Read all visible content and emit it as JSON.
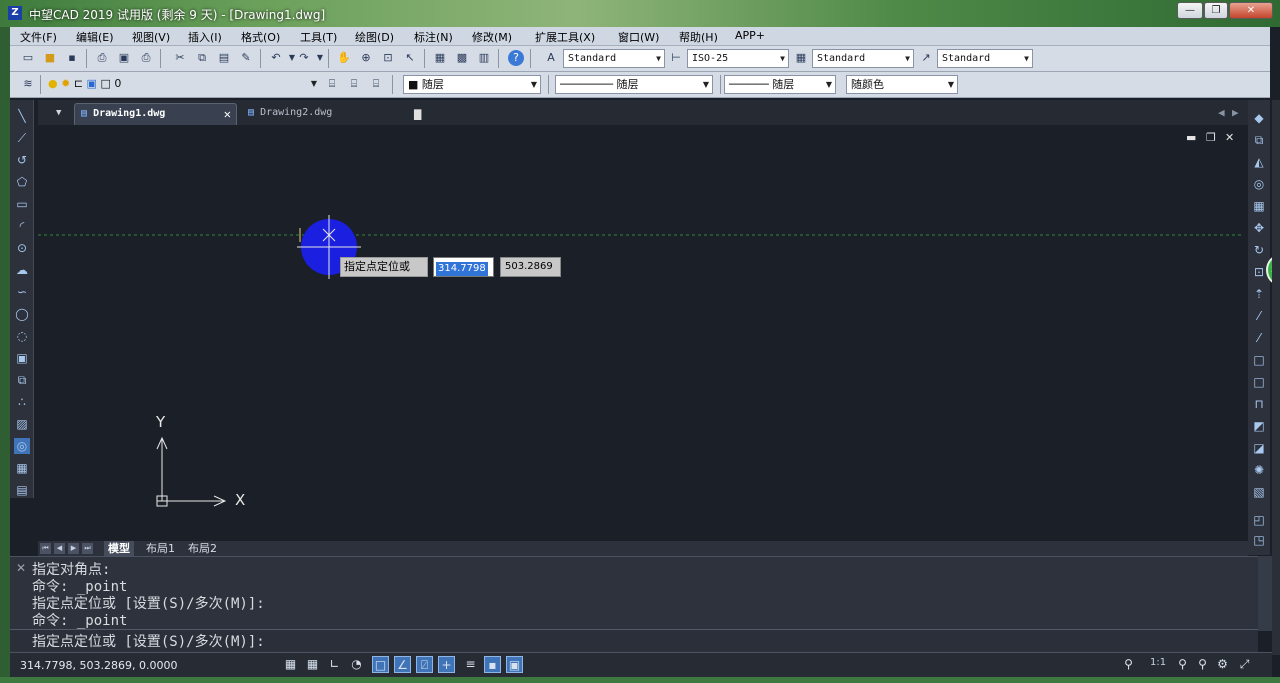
{
  "window": {
    "title": "中望CAD 2019 试用版 (剩余 9 天) - [Drawing1.dwg]",
    "minimize": "—",
    "restore": "❐",
    "close": "✕"
  },
  "menu": [
    "文件(F)",
    "编辑(E)",
    "视图(V)",
    "插入(I)",
    "格式(O)",
    "工具(T)",
    "绘图(D)",
    "标注(N)",
    "修改(M)",
    "扩展工具(X)",
    "窗口(W)",
    "帮助(H)",
    "APP+"
  ],
  "toolbar1": {
    "text_style": "Standard",
    "dim_style": "ISO-25",
    "table_style": "Standard",
    "mleader_style": "Standard"
  },
  "toolbar2": {
    "layer": "0",
    "color": "随层",
    "linetype": "随层",
    "lineweight": "随层",
    "plotstyle": "随颜色"
  },
  "tabs": [
    {
      "label": "Drawing1.dwg",
      "active": true
    },
    {
      "label": "Drawing2.dwg",
      "active": false
    }
  ],
  "canvas": {
    "tooltip": "指定点定位或",
    "x_value": "314.7798",
    "y_value": "503.2869",
    "ucs_x": "X",
    "ucs_y": "Y"
  },
  "layout_tabs": [
    "模型",
    "布局1",
    "布局2"
  ],
  "command_history": [
    "指定对角点:",
    "命令: _point",
    "指定点定位或 [设置(S)/多次(M)]:",
    "命令: _point"
  ],
  "command_prompt": "指定点定位或 [设置(S)/多次(M)]:",
  "status": {
    "coordinates": "314.7798, 503.2869, 0.0000",
    "scale": "1:1"
  },
  "colors": {
    "canvas_bg": "#1b1f27",
    "point_fill": "#1a1fe0",
    "guide_line": "#2e8b3a",
    "accent": "#3f74b8"
  }
}
